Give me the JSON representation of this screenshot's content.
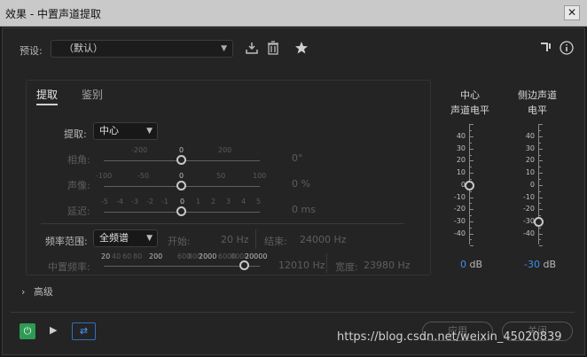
{
  "window": {
    "title": "效果 - 中置声道提取",
    "close_glyph": "✕"
  },
  "preset": {
    "label": "预设:",
    "value": "（默认）"
  },
  "toolbar_icons": [
    "save-preset-icon",
    "delete-icon",
    "star-icon",
    "routing-icon",
    "info-icon"
  ],
  "tabs": [
    {
      "label": "提取",
      "active": true
    },
    {
      "label": "鉴别",
      "active": false
    }
  ],
  "extract": {
    "label": "提取:",
    "value": "中心"
  },
  "phase": {
    "label": "相角:",
    "scale": [
      "-200",
      "0",
      "200"
    ],
    "value": "0°"
  },
  "pan": {
    "label": "声像:",
    "scale": [
      "-100",
      "-50",
      "0",
      "50",
      "100"
    ],
    "value": "0 %"
  },
  "delay": {
    "label": "延迟:",
    "scale": [
      "-5",
      "-4",
      "-3",
      "-2",
      "-1",
      "0",
      "1",
      "2",
      "3",
      "4",
      "5"
    ],
    "value": "0 ms"
  },
  "freq_range": {
    "label": "频率范围:",
    "value": "全频谱",
    "start_label": "开始:",
    "start_value": "20 Hz",
    "end_label": "结束:",
    "end_value": "24000 Hz"
  },
  "center_freq": {
    "label": "中置频率:",
    "scale": [
      "20",
      "40",
      "60",
      "80",
      "200",
      "600",
      "800",
      "2000",
      "6000",
      "8000",
      "20000"
    ],
    "value": "12010 Hz",
    "width_label": "宽度:",
    "width_value": "23980 Hz"
  },
  "meters": [
    {
      "title_line1": "中心",
      "title_line2": "声道电平",
      "value": "0",
      "unit": "dB",
      "level_db": 0
    },
    {
      "title_line1": "侧边声道",
      "title_line2": "电平",
      "value": "-30",
      "unit": "dB",
      "level_db": -30
    }
  ],
  "meter_scale": [
    "40",
    "30",
    "20",
    "10",
    "0",
    "-10",
    "-20",
    "-30",
    "-40"
  ],
  "advanced": {
    "chevron": "›",
    "label": "高级"
  },
  "footer": {
    "power_glyph": "⏻",
    "play_glyph": "▶",
    "loop_glyph": "⇄",
    "apply_label": "应用",
    "close_label": "关闭"
  },
  "watermark": "https://blog.csdn.net/weixin_45020839",
  "colors": {
    "accent_blue": "#3d8fe8",
    "power_green": "#2f9a56"
  }
}
